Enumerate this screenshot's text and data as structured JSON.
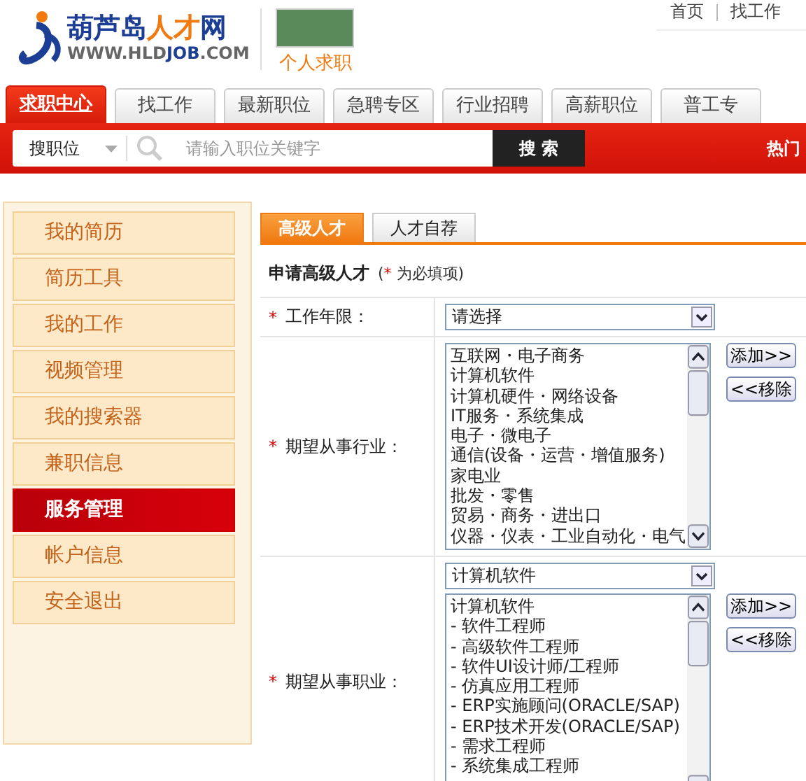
{
  "header": {
    "logo": {
      "name_parts": [
        "葫芦岛",
        "人才",
        "网"
      ],
      "url_parts": [
        "WWW.HLD",
        "JOB",
        ".COM"
      ]
    },
    "channel": "个人求职",
    "top_links": [
      "首页",
      "找工作"
    ]
  },
  "nav": {
    "tabs": [
      {
        "label": "求职中心",
        "selected": true
      },
      {
        "label": "找工作",
        "selected": false
      },
      {
        "label": "最新职位",
        "selected": false
      },
      {
        "label": "急聘专区",
        "selected": false
      },
      {
        "label": "行业招聘",
        "selected": false
      },
      {
        "label": "高薪职位",
        "selected": false
      },
      {
        "label": "普工专",
        "selected": false
      }
    ]
  },
  "search": {
    "type": "搜职位",
    "placeholder": "请输入职位关键字",
    "button": "搜 索",
    "hot_label": "热门"
  },
  "sidebar": {
    "items": [
      {
        "label": "我的简历",
        "selected": false
      },
      {
        "label": "简历工具",
        "selected": false
      },
      {
        "label": "我的工作",
        "selected": false
      },
      {
        "label": "视频管理",
        "selected": false
      },
      {
        "label": "我的搜索器",
        "selected": false
      },
      {
        "label": "兼职信息",
        "selected": false
      },
      {
        "label": "服务管理",
        "selected": true
      },
      {
        "label": "帐户信息",
        "selected": false
      },
      {
        "label": "安全退出",
        "selected": false
      }
    ]
  },
  "content": {
    "tabs": [
      {
        "label": "高级人才",
        "selected": true
      },
      {
        "label": "人才自荐",
        "selected": false
      }
    ],
    "heading": "申请高级人才",
    "required_note": [
      "(",
      "*",
      "为必填项)"
    ],
    "rows": [
      {
        "kind": "select",
        "required": true,
        "label": "工作年限：",
        "value": "请选择"
      },
      {
        "kind": "listbox",
        "required": true,
        "label": "期望从事行业：",
        "options": [
          "互联网・电子商务",
          "计算机软件",
          "计算机硬件・网络设备",
          "IT服务・系统集成",
          "电子・微电子",
          "通信(设备・运营・增值服务)",
          "家电业",
          "批发・零售",
          "贸易・商务・进出口",
          "仪器・仪表・工业自动化・电气"
        ],
        "add": "添加>>",
        "remove": "<<移除"
      },
      {
        "kind": "select-listbox",
        "required": true,
        "label": "期望从事职业：",
        "value": "计算机软件",
        "options": [
          "计算机软件",
          "- 软件工程师",
          "- 高级软件工程师",
          "- 软件UI设计师/工程师",
          "- 仿真应用工程师",
          "- ERP实施顾问(ORACLE/SAP)",
          "- ERP技术开发(ORACLE/SAP)",
          "- 需求工程师",
          "- 系统集成工程师"
        ],
        "add": "添加>>",
        "remove": "<<移除"
      }
    ]
  }
}
